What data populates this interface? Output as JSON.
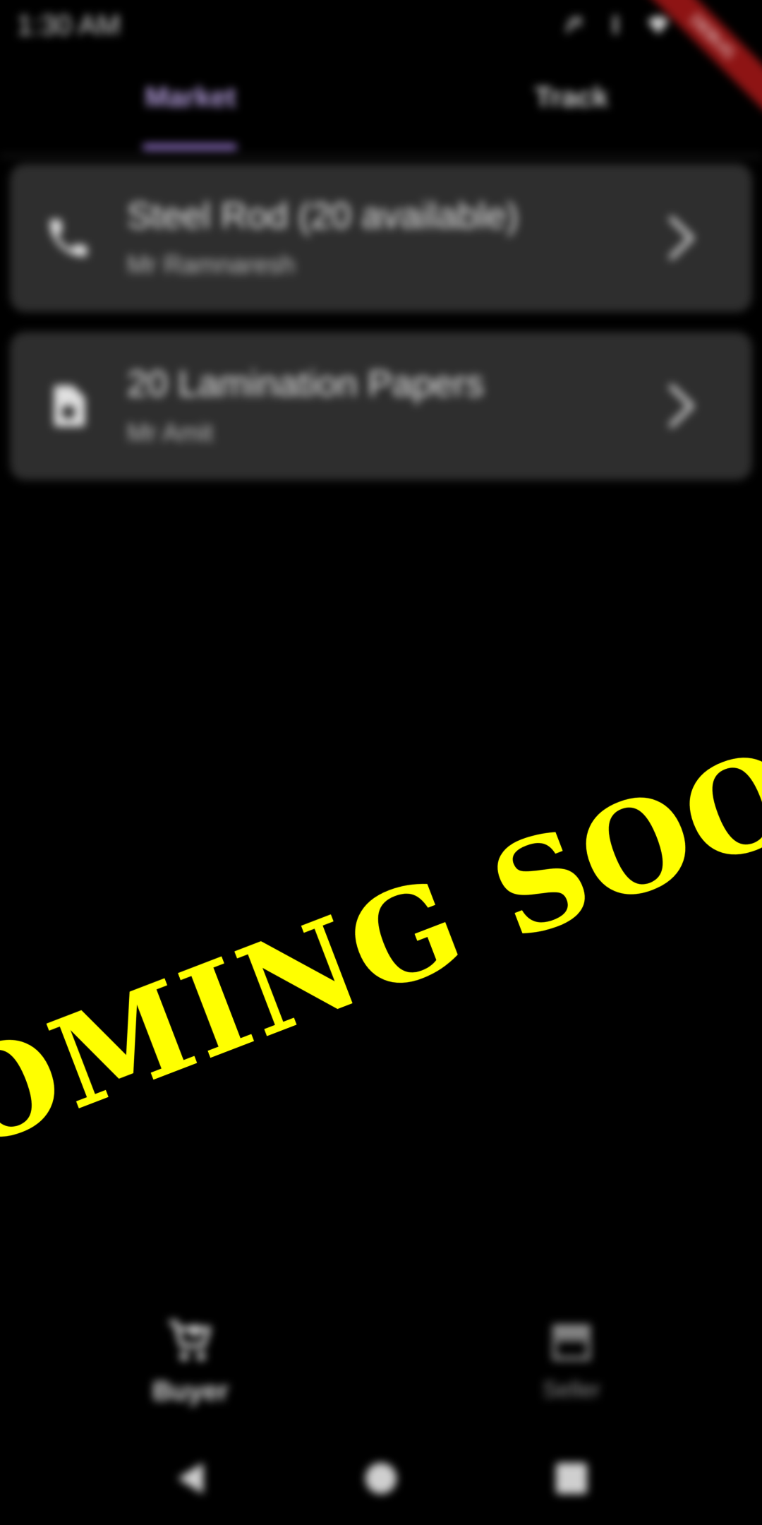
{
  "status_bar": {
    "time": "1:30 AM",
    "icons": [
      "silent-icon",
      "signal-icon",
      "wifi-icon",
      "battery-icon"
    ]
  },
  "debug_banner": "DEBUG",
  "tabs": [
    {
      "label": "Market",
      "selected": true
    },
    {
      "label": "Track",
      "selected": false
    }
  ],
  "listings": [
    {
      "title": "Steel Rod (20 available)",
      "subtitle": "Mr Ramnaresh",
      "icon": "phone-icon"
    },
    {
      "title": "20 Lamination Papers",
      "subtitle": "Mr Amit",
      "icon": "document-icon"
    }
  ],
  "bottom_nav": [
    {
      "label": "Buyer",
      "icon": "cart-icon",
      "selected": true
    },
    {
      "label": "Seller",
      "icon": "store-icon",
      "selected": false
    }
  ],
  "overlay": {
    "text": "COMING SOON"
  },
  "colors": {
    "background": "#000000",
    "card": "#2e2e2e",
    "accent": "#9575cd",
    "overlay_text": "#ffff00",
    "debug_banner": "#8e1414"
  }
}
